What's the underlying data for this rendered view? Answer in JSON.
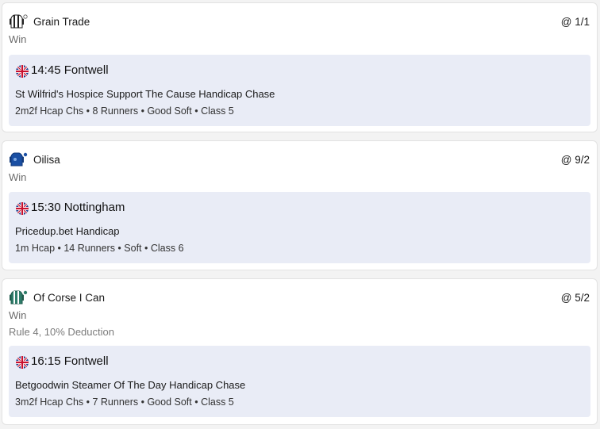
{
  "selections": [
    {
      "horse": "Grain Trade",
      "odds": "@ 1/1",
      "bet_type": "Win",
      "note": "",
      "silk_icon": "silk-black-white-icon",
      "race": {
        "time_course": "14:45 Fontwell",
        "name": "St Wilfrid's Hospice Support The Cause Handicap Chase",
        "details": "2m2f Hcap Chs • 8 Runners • Good Soft • Class 5",
        "flag_icon": "uk-flag-icon"
      }
    },
    {
      "horse": "Oilisa",
      "odds": "@ 9/2",
      "bet_type": "Win",
      "note": "",
      "silk_icon": "silk-blue-icon",
      "race": {
        "time_course": "15:30 Nottingham",
        "name": "Pricedup.bet Handicap",
        "details": "1m Hcap • 14 Runners • Soft • Class 6",
        "flag_icon": "uk-flag-icon"
      }
    },
    {
      "horse": "Of Corse I Can",
      "odds": "@ 5/2",
      "bet_type": "Win",
      "note": "Rule 4, 10% Deduction",
      "silk_icon": "silk-green-white-icon",
      "race": {
        "time_course": "16:15 Fontwell",
        "name": "Betgoodwin Steamer Of The Day Handicap Chase",
        "details": "3m2f Hcap Chs • 7 Runners • Good Soft • Class 5",
        "flag_icon": "uk-flag-icon"
      }
    }
  ],
  "colors": {
    "race_panel_bg": "#e9ecf6",
    "card_bg": "#ffffff",
    "muted_text": "#6b6b6b"
  }
}
